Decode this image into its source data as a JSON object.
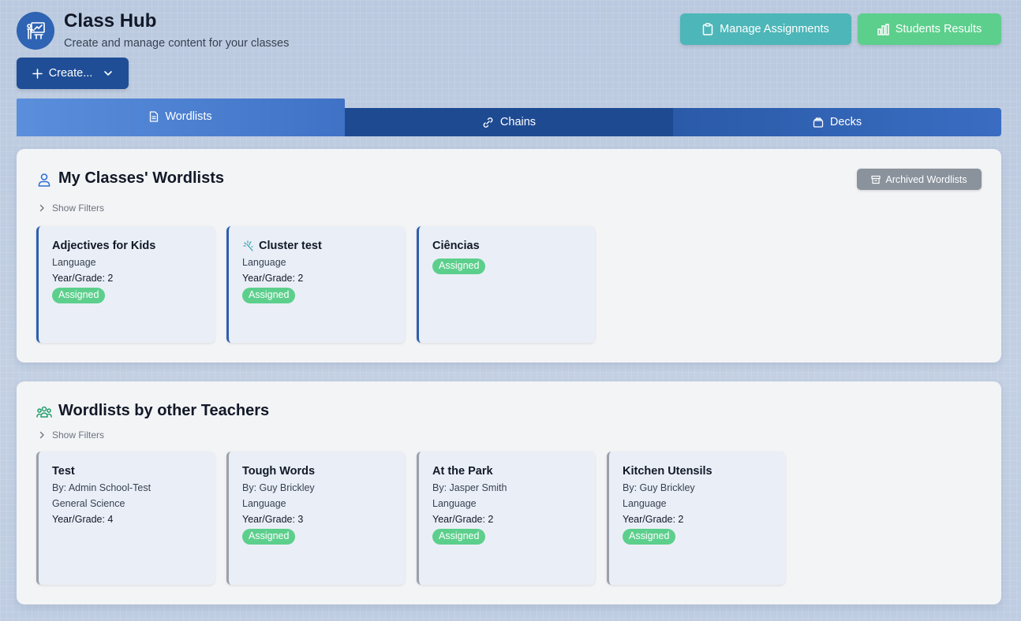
{
  "header": {
    "title": "Class Hub",
    "subtitle": "Create and manage content for your classes",
    "manage_assignments_label": "Manage Assignments",
    "students_results_label": "Students Results",
    "create_label": "Create..."
  },
  "tabs": [
    {
      "label": "Wordlists",
      "active": true
    },
    {
      "label": "Chains",
      "active": false
    },
    {
      "label": "Decks",
      "active": false
    }
  ],
  "my_classes": {
    "title": "My Classes' Wordlists",
    "show_filters": "Show Filters",
    "archived_label": "Archived Wordlists",
    "cards": [
      {
        "title": "Adjectives for Kids",
        "subject": "Language",
        "grade": "Year/Grade: 2",
        "status": "Assigned"
      },
      {
        "title": "Cluster test",
        "subject": "Language",
        "grade": "Year/Grade: 2",
        "status": "Assigned"
      },
      {
        "title": "Ciências",
        "status": "Assigned"
      }
    ]
  },
  "other_teachers": {
    "title": "Wordlists by other Teachers",
    "show_filters": "Show Filters",
    "cards": [
      {
        "title": "Test",
        "author": "By: Admin School-Test",
        "subject": "General Science",
        "grade": "Year/Grade: 4"
      },
      {
        "title": "Tough Words",
        "author": "By: Guy Brickley",
        "subject": "Language",
        "grade": "Year/Grade: 3",
        "status": "Assigned"
      },
      {
        "title": "At the Park",
        "author": "By: Jasper Smith",
        "subject": "Language",
        "grade": "Year/Grade: 2",
        "status": "Assigned"
      },
      {
        "title": "Kitchen Utensils",
        "author": "By: Guy Brickley",
        "subject": "Language",
        "grade": "Year/Grade: 2",
        "status": "Assigned"
      }
    ]
  },
  "colors": {
    "primary": "#1f4e96",
    "teal": "#4db6b8",
    "green": "#5ccf8c",
    "badge": "#5ccf8c"
  }
}
